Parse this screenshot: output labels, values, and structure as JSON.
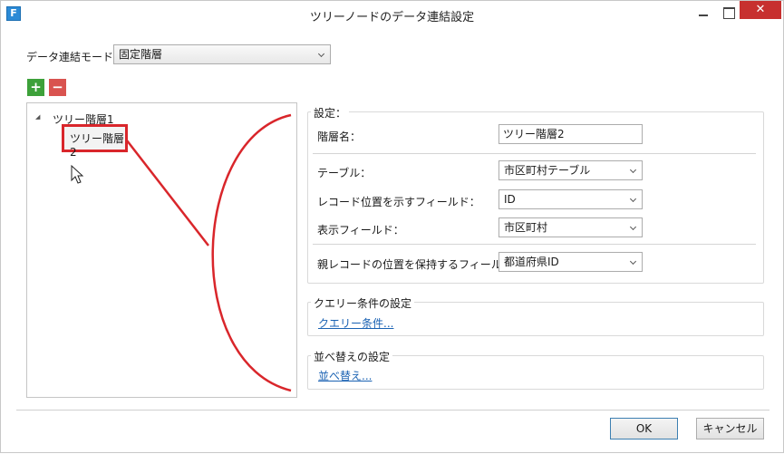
{
  "window": {
    "title": "ツリーノードのデータ連結設定",
    "app_icon_letter": "F",
    "minimize_glyph": "",
    "close_glyph": "✕"
  },
  "mode": {
    "label": "データ連結モード：",
    "value": "固定階層"
  },
  "tree_toolbar": {
    "add_glyph": "+",
    "remove_glyph": "−",
    "add_color": "#3da13a",
    "remove_color": "#d9534f"
  },
  "tree": {
    "expand_glyph": "◢",
    "root_label": "ツリー階層1",
    "child_label": "ツリー階層2"
  },
  "settings": {
    "group_title": "設定：",
    "level_name_label": "階層名：",
    "level_name_value": "ツリー階層2",
    "table_label": "テーブル：",
    "table_value": "市区町村テーブル",
    "record_pos_label": "レコード位置を示すフィールド：",
    "record_pos_value": "ID",
    "display_field_label": "表示フィールド：",
    "display_field_value": "市区町村",
    "parent_pos_label": "親レコードの位置を保持するフィールド：",
    "parent_pos_value": "都道府県ID"
  },
  "query": {
    "group_title": "クエリー条件の設定",
    "link": "クエリー条件..."
  },
  "sort": {
    "group_title": "並べ替えの設定",
    "link": "並べ替え..."
  },
  "footer": {
    "ok_label": "OK",
    "cancel_label": "キャンセル"
  },
  "colors": {
    "annotation_red": "#d9262b",
    "highlight_border": "#d9262b",
    "link_blue": "#1a62b3",
    "close_red": "#c7302f"
  },
  "icons": {
    "cursor": "mouse-pointer-icon",
    "app": "app-icon"
  }
}
